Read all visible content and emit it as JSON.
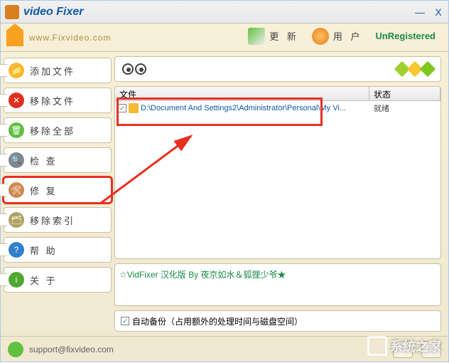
{
  "app_title": "video Fixer",
  "website": "www.Fixvideo.com",
  "window_controls": {
    "min": "—",
    "close": "X"
  },
  "toolbar": {
    "update": "更 新",
    "user": "用 户",
    "unregistered": "UnRegistered"
  },
  "sidebar": {
    "add": "添加文件",
    "remove": "移除文件",
    "remove_all": "移除全部",
    "check": "检 查",
    "fix": "修 复",
    "remove_index": "移除索引",
    "help": "帮 助",
    "about": "关 于"
  },
  "list": {
    "col_file": "文件",
    "col_status": "状态",
    "rows": [
      {
        "checked": true,
        "path": "D:\\Document And Settings2\\Administrator\\Personal\\My Vi...",
        "status": "就绪"
      }
    ]
  },
  "info_text": "☆VidFixer 汉化版 By 夜京如水＆狐狸少爷★",
  "backup": {
    "checked": true,
    "label": "自动备份（占用额外的处理时间与磁盘空间）"
  },
  "footer": {
    "email": "support@fixvideo.com"
  },
  "watermark": "系统之家"
}
